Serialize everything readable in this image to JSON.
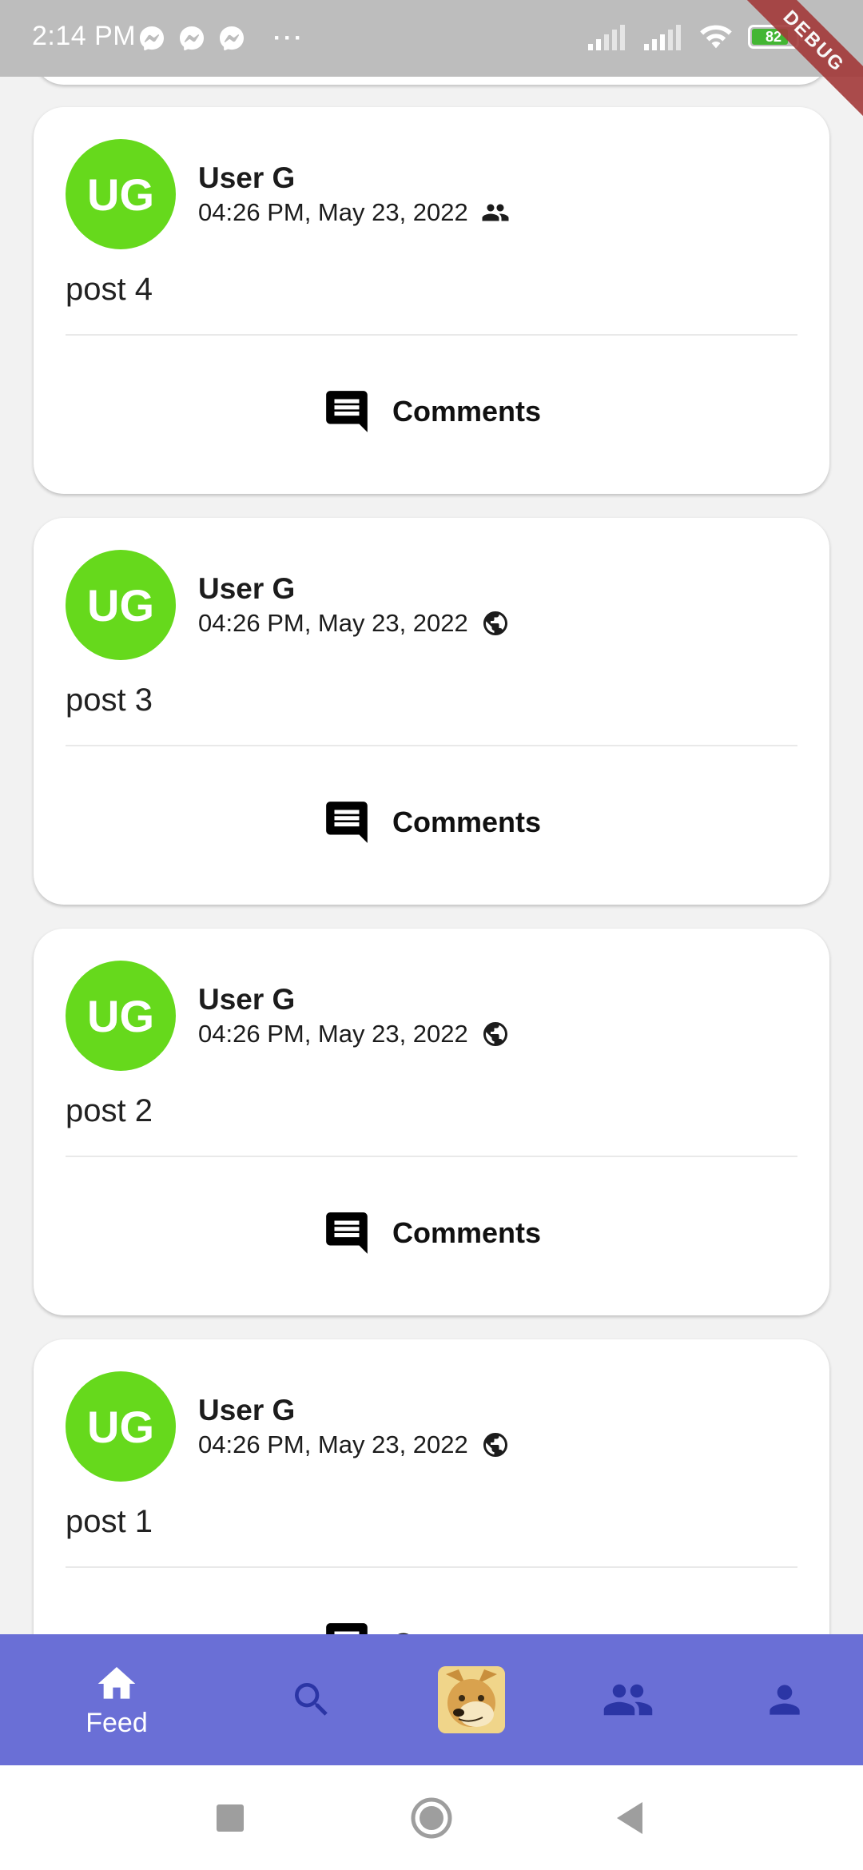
{
  "status_bar": {
    "time": "2:14 PM",
    "battery": "82",
    "notification_icons": [
      "messenger-icon",
      "messenger-icon",
      "messenger-icon"
    ],
    "overflow": "···",
    "ribbon": "DEBUG"
  },
  "posts": [
    {
      "author": "User G",
      "initials": "UG",
      "date": "04:26 PM, May 23, 2022",
      "visibility": "friends-icon",
      "text": "post 4",
      "comments_label": "Comments"
    },
    {
      "author": "User G",
      "initials": "UG",
      "date": "04:26 PM, May 23, 2022",
      "visibility": "globe-icon",
      "text": "post 3",
      "comments_label": "Comments"
    },
    {
      "author": "User G",
      "initials": "UG",
      "date": "04:26 PM, May 23, 2022",
      "visibility": "globe-icon",
      "text": "post 2",
      "comments_label": "Comments"
    },
    {
      "author": "User G",
      "initials": "UG",
      "date": "04:26 PM, May 23, 2022",
      "visibility": "globe-icon",
      "text": "post 1",
      "comments_label": "Comments"
    }
  ],
  "bottom_nav": {
    "items": [
      {
        "name": "home-icon",
        "label": "Feed",
        "active": true
      },
      {
        "name": "search-icon"
      },
      {
        "name": "doge-avatar"
      },
      {
        "name": "friends-icon"
      },
      {
        "name": "profile-icon"
      }
    ]
  },
  "colors": {
    "avatar": "#66d91c",
    "nav_bg": "#6a6fd6",
    "nav_icon": "#2b35a5",
    "status_bar": "#bdbdbd"
  }
}
